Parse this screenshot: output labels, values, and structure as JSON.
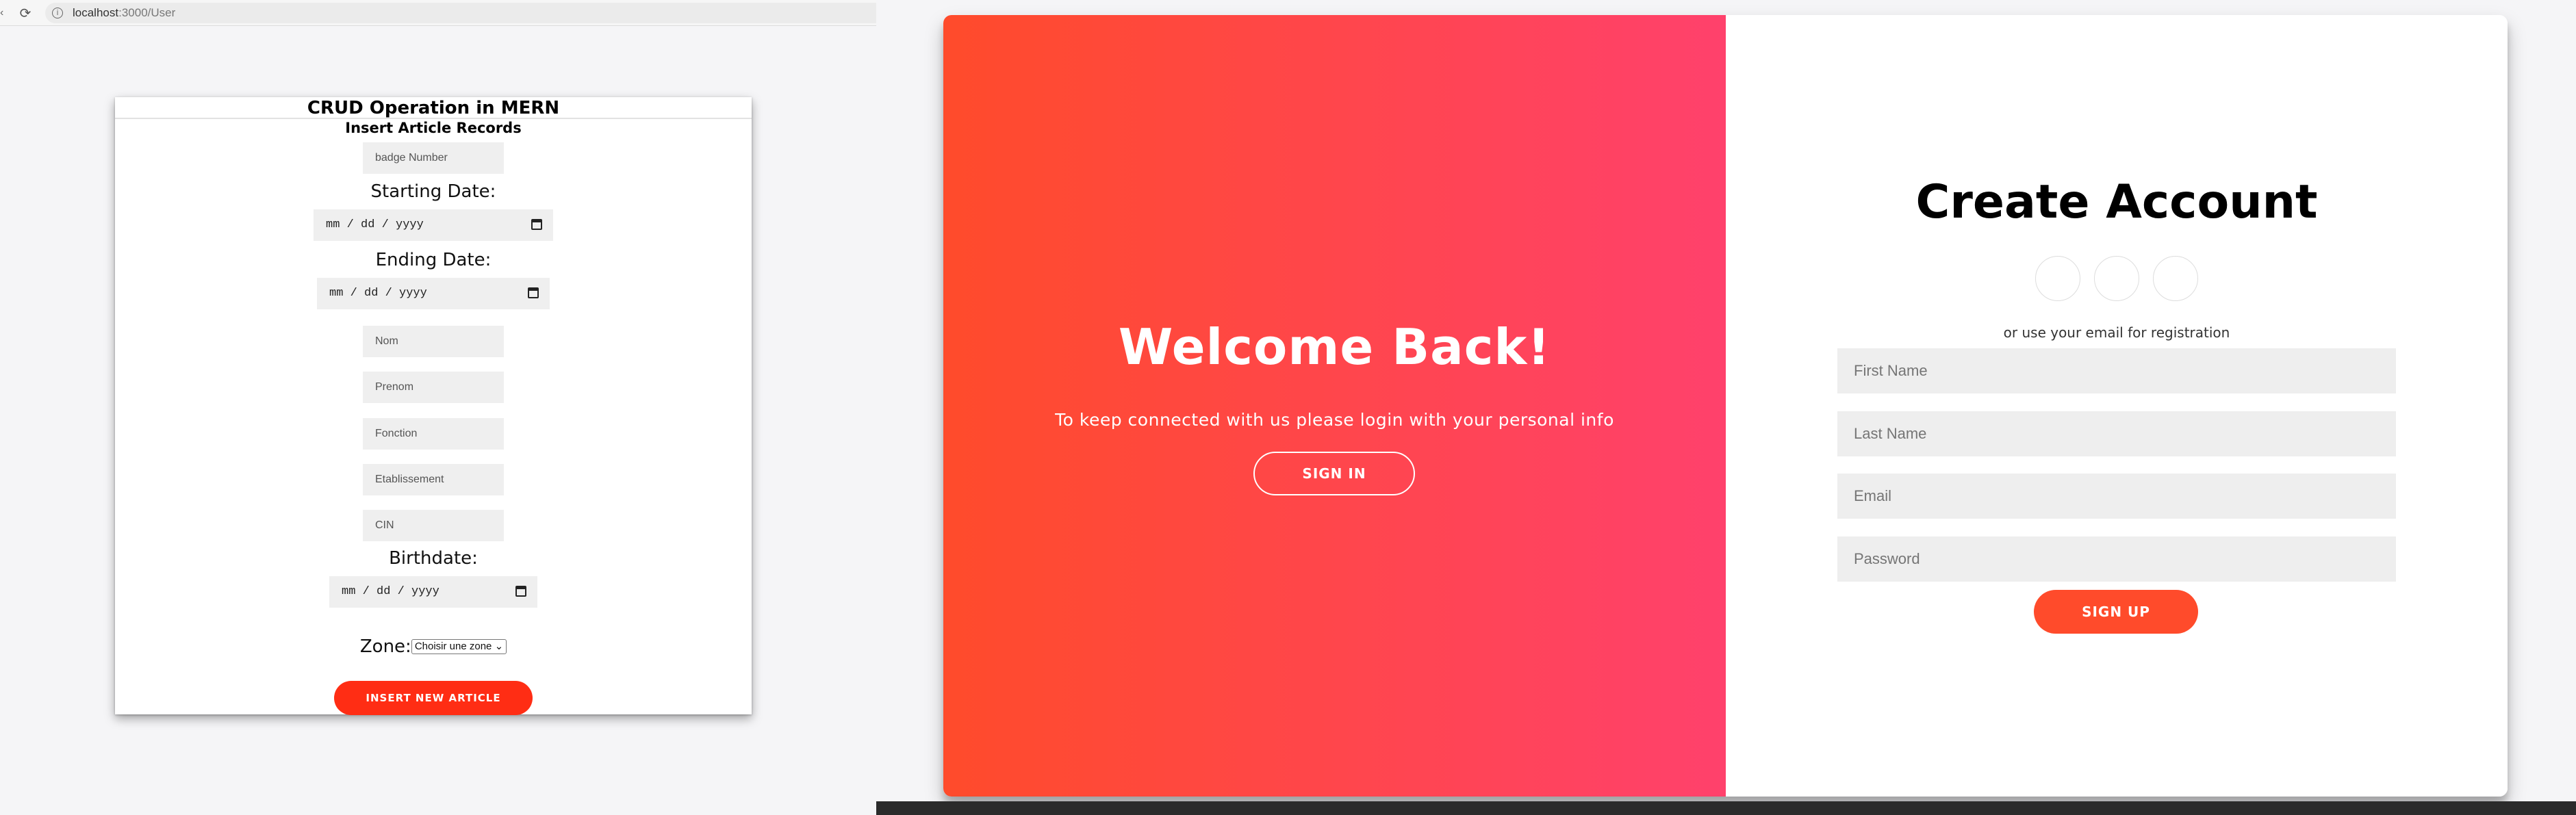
{
  "browser": {
    "back_glyph": "‹",
    "reload_glyph": "⟳",
    "info_glyph": "i",
    "url_host": "localhost",
    "url_path": ":3000/User"
  },
  "crud_form": {
    "title": "CRUD Operation in MERN",
    "subtitle": "Insert Article Records",
    "badge_placeholder": "badge Number",
    "starting_date_label": "Starting Date:",
    "starting_date_value": "mm / dd / yyyy",
    "ending_date_label": "Ending Date:",
    "ending_date_value": "mm / dd / yyyy",
    "nom_placeholder": "Nom",
    "prenom_placeholder": "Prenom",
    "fonction_placeholder": "Fonction",
    "etablissement_placeholder": "Etablissement",
    "cin_placeholder": "CIN",
    "birthdate_label": "Birthdate:",
    "birthdate_value": "mm / dd / yyyy",
    "zone_label": "Zone:",
    "zone_select": "Choisir une zone",
    "zone_chevron": "⌄",
    "insert_button": "INSERT NEW ARTICLE",
    "button_color": "#ff2d14"
  },
  "welcome_panel": {
    "title": "Welcome Back!",
    "text": "To keep connected with us please login with your personal info",
    "signin_button": "SIGN IN",
    "gradient_start": "#ff4b2b",
    "gradient_end": "#ff416c"
  },
  "register_panel": {
    "title": "Create Account",
    "social_icons": [
      "social-icon-1",
      "social-icon-2",
      "social-icon-3"
    ],
    "reg_text": "or use your email for registration",
    "first_name_placeholder": "First Name",
    "last_name_placeholder": "Last Name",
    "email_placeholder": "Email",
    "password_placeholder": "Password",
    "signup_button": "SIGN UP",
    "button_color": "#ff4b2b"
  }
}
